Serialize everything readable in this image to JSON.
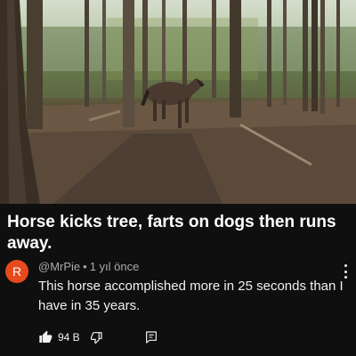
{
  "video": {
    "scene_icon": "forest-horse-scene"
  },
  "post": {
    "title": "Horse kicks tree, farts on dogs then runs away."
  },
  "comment": {
    "avatar_letter": "R",
    "avatar_color": "#e8491d",
    "author": "@MrPie",
    "separator": "•",
    "time": "1 yıl önce",
    "text": "This horse accomplished more in 25 seconds than I have in 35 years.",
    "like_count": "94 B",
    "icons": {
      "like": "thumbs-up-icon",
      "dislike": "thumbs-down-icon",
      "reply": "reply-icon",
      "more": "more-vert-icon"
    }
  },
  "colors": {
    "background": "#0f0f0f",
    "text": "#f1f1f1",
    "muted": "#aaaaaa"
  }
}
